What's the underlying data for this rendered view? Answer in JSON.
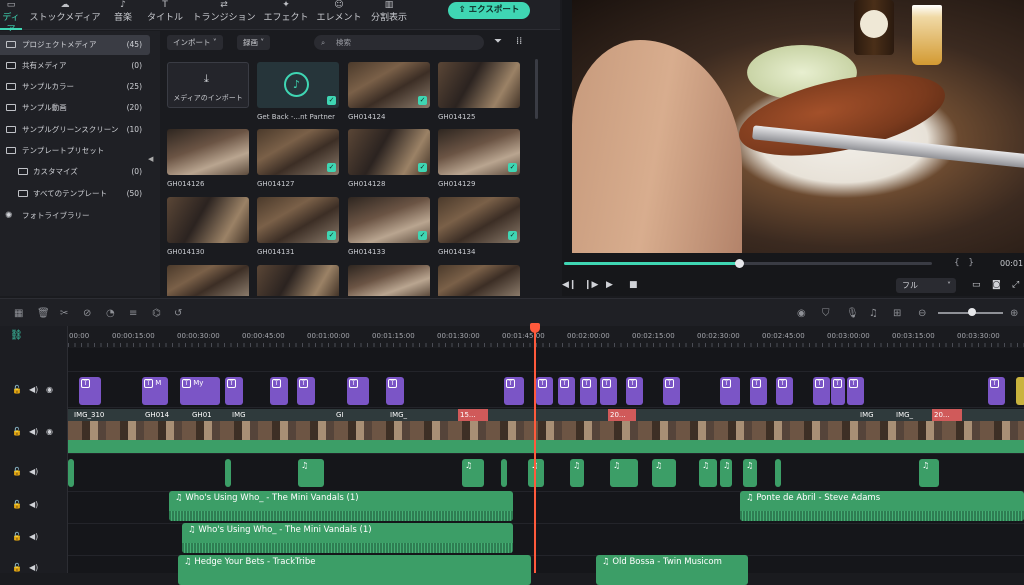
{
  "top_tabs": [
    {
      "label": "ディア",
      "icon": "media-icon",
      "active": true
    },
    {
      "label": "ストックメディア",
      "icon": "cloud-icon"
    },
    {
      "label": "音楽",
      "icon": "music-icon"
    },
    {
      "label": "タイトル",
      "icon": "title-icon"
    },
    {
      "label": "トランジション",
      "icon": "transition-icon"
    },
    {
      "label": "エフェクト",
      "icon": "effect-icon"
    },
    {
      "label": "エレメント",
      "icon": "element-icon"
    },
    {
      "label": "分割表示",
      "icon": "split-icon"
    }
  ],
  "export_label": "エクスポート",
  "sidebar": [
    {
      "label": "プロジェクトメディア",
      "count": "(45)",
      "selected": true
    },
    {
      "label": "共有メディア",
      "count": "(0)"
    },
    {
      "label": "サンプルカラー",
      "count": "(25)"
    },
    {
      "label": "サンプル動画",
      "count": "(20)"
    },
    {
      "label": "サンプルグリーンスクリーン",
      "count": "(10)"
    },
    {
      "label": "テンプレートプリセット",
      "count": ""
    },
    {
      "label": "カスタマイズ",
      "count": "(0)"
    },
    {
      "label": "すべてのテンプレート",
      "count": "(50)"
    },
    {
      "label": "フォトライブラリー",
      "count": ""
    }
  ],
  "media_bar": {
    "import": "インポート",
    "record": "録画",
    "search_placeholder": "検索"
  },
  "media_tiles": [
    {
      "label": "メディアのインポート",
      "caption": ""
    },
    {
      "label": "",
      "caption": "Get Back -...nt Partner"
    },
    {
      "label": "",
      "caption": "GH014124"
    },
    {
      "label": "",
      "caption": "GH014125"
    },
    {
      "label": "",
      "caption": "GH014126"
    },
    {
      "label": "",
      "caption": "GH014127"
    },
    {
      "label": "",
      "caption": "GH014128"
    },
    {
      "label": "",
      "caption": "GH014129"
    },
    {
      "label": "",
      "caption": "GH014130"
    },
    {
      "label": "",
      "caption": "GH014131"
    },
    {
      "label": "",
      "caption": "GH014133"
    },
    {
      "label": "",
      "caption": "GH014134"
    }
  ],
  "preview": {
    "timecode": "00:01",
    "quality": "フル",
    "progress": 0.48
  },
  "ruler_ticks": [
    "00:00",
    "00:00:15:00",
    "00:00:30:00",
    "00:00:45:00",
    "00:01:00:00",
    "00:01:15:00",
    "00:01:30:00",
    "00:01:45:00",
    "00:02:00:00",
    "00:02:15:00",
    "00:02:30:00",
    "00:02:45:00",
    "00:03:00:00",
    "00:03:15:00",
    "00:03:30:00"
  ],
  "title_clips": [
    "My",
    "M"
  ],
  "video_labels": [
    "IMG_310",
    "GH014",
    "GH01",
    "IMG",
    "GI",
    "IMG_",
    "15...",
    "20...",
    "IMG",
    "IMG_",
    "20..."
  ],
  "audio_tracks": [
    {
      "clips": [
        {
          "label": "Who's Using Who_ - The Mini Vandals (1)"
        },
        {
          "label": "Ponte de Abril - Steve Adams"
        }
      ]
    },
    {
      "clips": [
        {
          "label": "Who's Using Who_ - The Mini Vandals (1)"
        }
      ]
    },
    {
      "clips": [
        {
          "label": "Hedge Your Bets - TrackTribe"
        },
        {
          "label": "Old Bossa - Twin Musicom"
        }
      ]
    }
  ]
}
